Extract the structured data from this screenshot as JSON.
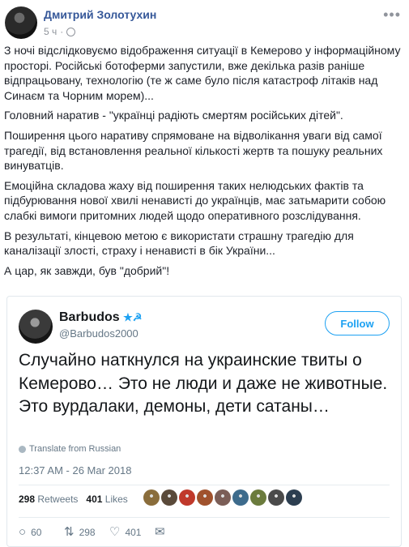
{
  "post": {
    "author": "Дмитрий Золотухин",
    "time": "5 ч",
    "paragraphs": [
      "З ночі відслідковуємо відображення ситуації в Кемерово у інформаційному просторі. Російські ботоферми запустили, вже декілька разів раніше відпрацьовану, технологію (те ж саме було після катастроф літаків над Синаєм та Чорним морем)...",
      "Головний наратив - \"українці радіють смертям російських дітей\".",
      "Поширення цього наративу спрямоване на відволікання уваги від самої трагедії, від встановлення реальної кількості жертв та пошуку реальних винуватців.",
      "Емоційна складова жаху від поширення таких нелюдських фактів та підбурювання нової хвилі ненависті до українців, має затьмарити собою слабкі вимоги притомних людей щодо оперативного розслідування.",
      "В результаті, кінцевою метою є використати страшну трагедію для каналізації злості, страху і ненависті в бік України...",
      "А цар, як завжди, був \"добрий\"!"
    ]
  },
  "tweet": {
    "name": "Barbudos",
    "name_symbols": "★☭",
    "handle": "@Barbudos2000",
    "follow_label": "Follow",
    "text": "Случайно наткнулся на украинские твиты о Кемерово… Это не люди и даже не животные. Это вурдалаки, демоны, дети сатаны…",
    "translate": "Translate from Russian",
    "timestamp": "12:37 AM - 26 Mar 2018",
    "retweets_count": "298",
    "retweets_label": "Retweets",
    "likes_count": "401",
    "likes_label": "Likes",
    "actions": {
      "replies": "60",
      "retweets": "298",
      "likes": "401"
    },
    "liker_colors": [
      "#8a6d3b",
      "#5a4a3a",
      "#c0392b",
      "#a0522d",
      "#7b5e57",
      "#3d6b8c",
      "#6b7b3d",
      "#4a4a4a",
      "#2c3e50"
    ]
  }
}
